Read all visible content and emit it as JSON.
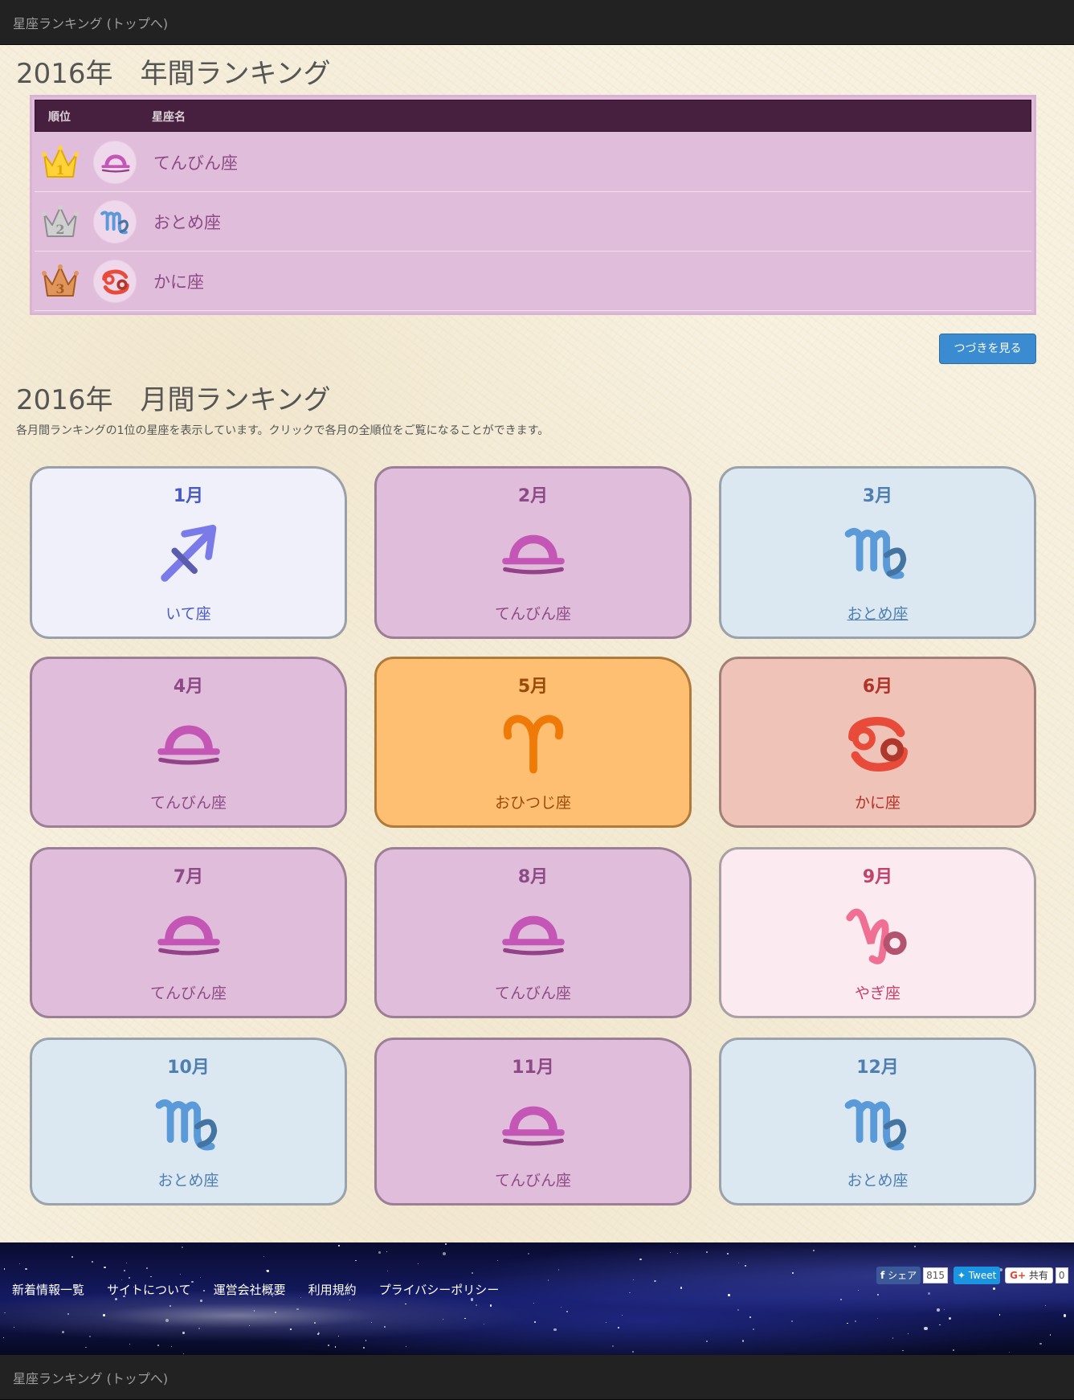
{
  "navbar": {
    "brand": "星座ランキング (トップへ)"
  },
  "annual": {
    "title": "2016年　年間ランキング",
    "header": {
      "rank": "順位",
      "name": "星座名"
    },
    "rows": [
      {
        "rank": "1",
        "sign": "libra",
        "name": "てんびん座"
      },
      {
        "rank": "2",
        "sign": "virgo",
        "name": "おとめ座"
      },
      {
        "rank": "3",
        "sign": "cancer",
        "name": "かに座"
      }
    ],
    "more_button": "つづきを見る"
  },
  "monthly": {
    "title": "2016年　月間ランキング",
    "description": "各月間ランキングの1位の星座を表示しています。クリックで各月の全順位をご覧になることができます。",
    "cards": [
      {
        "month": "1月",
        "sign": "sagittarius-icon",
        "name": "いて座"
      },
      {
        "month": "2月",
        "sign": "libra-icon",
        "name": "てんびん座"
      },
      {
        "month": "3月",
        "sign": "virgo-icon",
        "name": "おとめ座"
      },
      {
        "month": "4月",
        "sign": "libra-icon",
        "name": "てんびん座"
      },
      {
        "month": "5月",
        "sign": "aries-icon",
        "name": "おひつじ座"
      },
      {
        "month": "6月",
        "sign": "cancer-icon",
        "name": "かに座"
      },
      {
        "month": "7月",
        "sign": "libra-icon",
        "name": "てんびん座"
      },
      {
        "month": "8月",
        "sign": "libra-icon",
        "name": "てんびん座"
      },
      {
        "month": "9月",
        "sign": "capricorn-icon",
        "name": "やぎ座"
      },
      {
        "month": "10月",
        "sign": "virgo-icon",
        "name": "おとめ座"
      },
      {
        "month": "11月",
        "sign": "libra-icon",
        "name": "てんびん座"
      },
      {
        "month": "12月",
        "sign": "virgo-icon",
        "name": "おとめ座"
      }
    ]
  },
  "footer": {
    "links": [
      "新着情報一覧",
      "サイトについて",
      "運営会社概要",
      "利用規約",
      "プライバシーポリシー"
    ],
    "share": {
      "facebook": "シェア",
      "facebook_count": "815",
      "twitter": "Tweet",
      "google": "共有",
      "google_count": "0"
    }
  },
  "colors": {
    "libra": {
      "bg": "#e0bedb",
      "border": "#9b7f97",
      "text": "#8e4a86",
      "icon": "#c456b5"
    },
    "virgo": {
      "bg": "#dbe8f2",
      "border": "#9aa3ab",
      "text": "#4e7fb0",
      "icon": "#5a9ad8"
    },
    "sagittarius": {
      "bg": "#f0f0fa",
      "border": "#9aa0a8",
      "text": "#4b5bc2",
      "icon": "#7a7ae8"
    },
    "aries": {
      "bg": "#ffbf73",
      "border": "#b07a3a",
      "text": "#9a4a08",
      "icon": "#f07a08"
    },
    "cancer": {
      "bg": "#efc3b8",
      "border": "#a08078",
      "text": "#b0332a",
      "icon": "#e84b3a"
    },
    "capricorn": {
      "bg": "#fbeaef",
      "border": "#a8a0a4",
      "text": "#c2426a",
      "icon": "#ef6f95"
    },
    "header_bg": "#47203f",
    "button_bg": "#3a8bd0"
  }
}
